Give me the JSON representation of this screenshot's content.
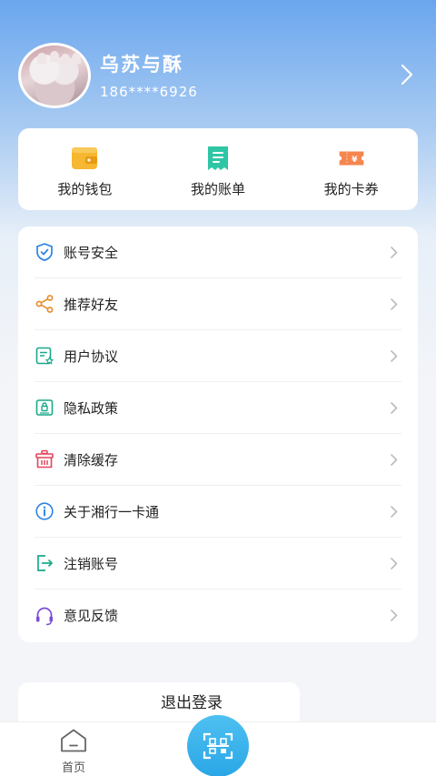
{
  "profile": {
    "nickname": "乌苏与酥",
    "phone": "186****6926"
  },
  "quick_actions": [
    {
      "label": "我的钱包",
      "icon": "wallet-icon",
      "color": "#f6b731"
    },
    {
      "label": "我的账单",
      "icon": "bill-icon",
      "color": "#2fc6a6"
    },
    {
      "label": "我的卡券",
      "icon": "coupon-icon",
      "color": "#f5864f"
    }
  ],
  "menu": [
    {
      "label": "账号安全",
      "icon": "shield-icon"
    },
    {
      "label": "推荐好友",
      "icon": "share-icon"
    },
    {
      "label": "用户协议",
      "icon": "agreement-icon"
    },
    {
      "label": "隐私政策",
      "icon": "privacy-icon"
    },
    {
      "label": "清除缓存",
      "icon": "clear-cache-icon"
    },
    {
      "label": "关于湘行一卡通",
      "icon": "info-icon"
    },
    {
      "label": "注销账号",
      "icon": "logout-account-icon"
    },
    {
      "label": "意见反馈",
      "icon": "headset-icon"
    }
  ],
  "logout_label": "退出登录",
  "tabbar": {
    "home_label": "首页",
    "scan_icon": "scan-icon"
  }
}
